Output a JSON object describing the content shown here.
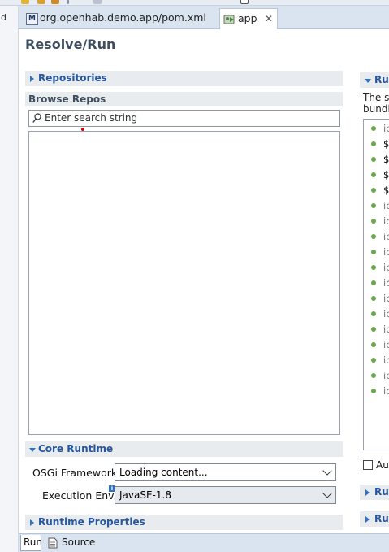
{
  "left_strip_label": "d",
  "tabs": [
    {
      "label": "org.openhab.demo.app/pom.xml",
      "icon": "maven-file-icon"
    },
    {
      "label": "app",
      "icon": "bndrun-icon",
      "close": "✕"
    }
  ],
  "page_title": "Resolve/Run",
  "repositories": {
    "label": "Repositories"
  },
  "browse_repos": {
    "label": "Browse Repos",
    "search_placeholder": "Enter search string"
  },
  "core_runtime": {
    "label": "Core Runtime",
    "osgi_label": "OSGi Framework:",
    "osgi_value": "Loading content...",
    "exec_label": "Execution Env.:",
    "exec_value": "JavaSE-1.8",
    "info_badge": "i"
  },
  "runtime_properties": {
    "label": "Runtime Properties"
  },
  "bottom_tabs": [
    {
      "label": "Run"
    },
    {
      "label": "Source"
    }
  ],
  "right_panel": {
    "header": "Run",
    "desc_line1": "The sp",
    "desc_line2": "bundl",
    "items": [
      "ic",
      "$",
      "$",
      "$",
      "$",
      "ic",
      "ic",
      "ic",
      "ic",
      "ic",
      "ic",
      "ic",
      "ic",
      "ic",
      "ic",
      "ic",
      "ic",
      "ic"
    ],
    "checkbox_label": "Au",
    "sec2": "Ru",
    "sec3": "Ru"
  },
  "colors": {
    "accent": "#2756a0",
    "tab_bar": "#dae4f1",
    "section_bg": "#e9ecef",
    "green_dot": "#6aa84f"
  }
}
